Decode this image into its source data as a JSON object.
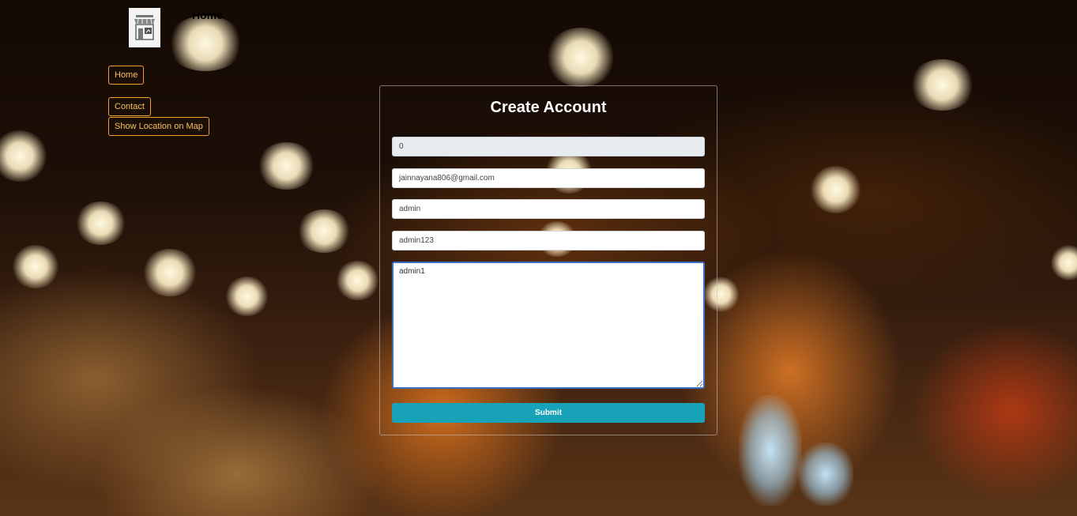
{
  "brand": {
    "title": "Home",
    "logo_icon": "storefront-icon"
  },
  "nav": {
    "home_label": "Home",
    "contact_label": "Contact",
    "map_label": "Show Location on Map"
  },
  "form": {
    "title": "Create Account",
    "fields": [
      {
        "value": "0",
        "readonly": true
      },
      {
        "value": "jainnayana806@gmail.com"
      },
      {
        "value": "admin"
      },
      {
        "value": "admin123"
      }
    ],
    "textarea_value": "admin1",
    "submit_label": "Submit"
  },
  "colors": {
    "nav_border": "#f0a030",
    "nav_text": "#f6c062",
    "submit_bg": "#17a2b8",
    "focus_border": "#3b6fc4"
  }
}
